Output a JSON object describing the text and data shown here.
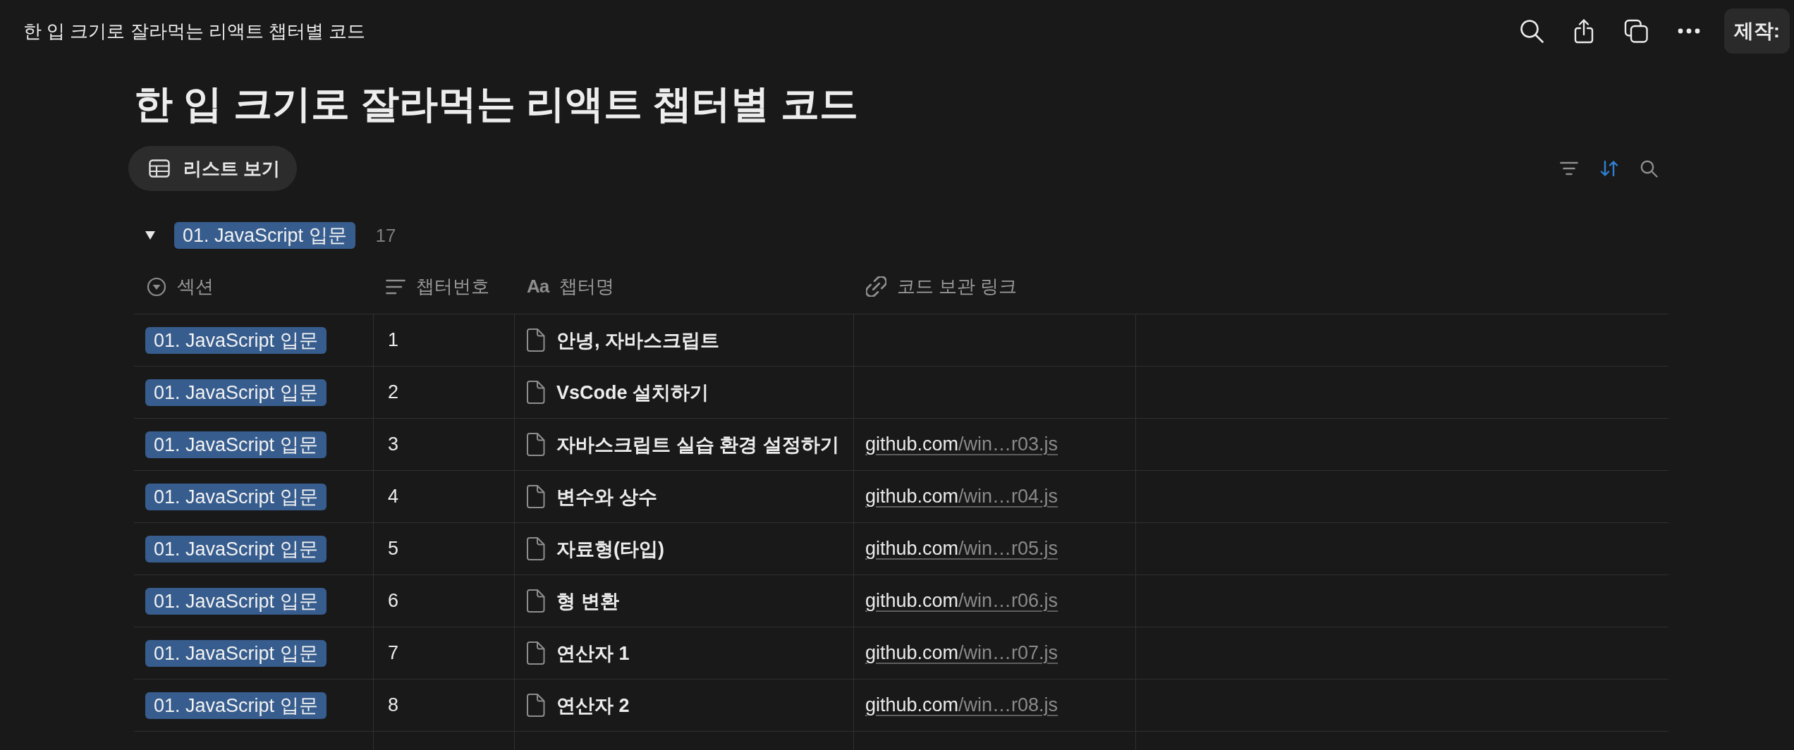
{
  "topbar": {
    "title": "한 입 크기로 잘라먹는 리액트 챕터별 코드",
    "credit_button": "제작:"
  },
  "page": {
    "title": "한 입 크기로 잘라먹는 리액트 챕터별 코드"
  },
  "views": [
    {
      "label": "리스트 보기",
      "selected": true
    }
  ],
  "toolbar": {
    "sort_active": true
  },
  "group": {
    "label": "01. JavaScript 입문",
    "count": "17",
    "expanded": true
  },
  "table": {
    "columns": [
      {
        "kind": "select",
        "label": "섹션"
      },
      {
        "kind": "text",
        "label": "챕터번호"
      },
      {
        "kind": "title",
        "icon": "Aa",
        "label": "챕터명"
      },
      {
        "kind": "url",
        "label": "코드 보관 링크"
      }
    ],
    "rows": [
      {
        "section": "01. JavaScript 입문",
        "number": "1",
        "title": "안녕, 자바스크립트"
      },
      {
        "section": "01. JavaScript 입문",
        "number": "2",
        "title": "VsCode 설치하기"
      },
      {
        "section": "01. JavaScript 입문",
        "number": "3",
        "title": "자바스크립트 실습 환경 설정하기",
        "link": {
          "domain": "github.com",
          "path": "/win…r03.js"
        }
      },
      {
        "section": "01. JavaScript 입문",
        "number": "4",
        "title": "변수와 상수",
        "link": {
          "domain": "github.com",
          "path": "/win…r04.js"
        }
      },
      {
        "section": "01. JavaScript 입문",
        "number": "5",
        "title": "자료형(타입)",
        "link": {
          "domain": "github.com",
          "path": "/win…r05.js"
        }
      },
      {
        "section": "01. JavaScript 입문",
        "number": "6",
        "title": "형 변환",
        "link": {
          "domain": "github.com",
          "path": "/win…r06.js"
        }
      },
      {
        "section": "01. JavaScript 입문",
        "number": "7",
        "title": "연산자 1",
        "link": {
          "domain": "github.com",
          "path": "/win…r07.js"
        }
      },
      {
        "section": "01. JavaScript 입문",
        "number": "8",
        "title": "연산자 2",
        "link": {
          "domain": "github.com",
          "path": "/win…r08.js"
        }
      }
    ]
  }
}
